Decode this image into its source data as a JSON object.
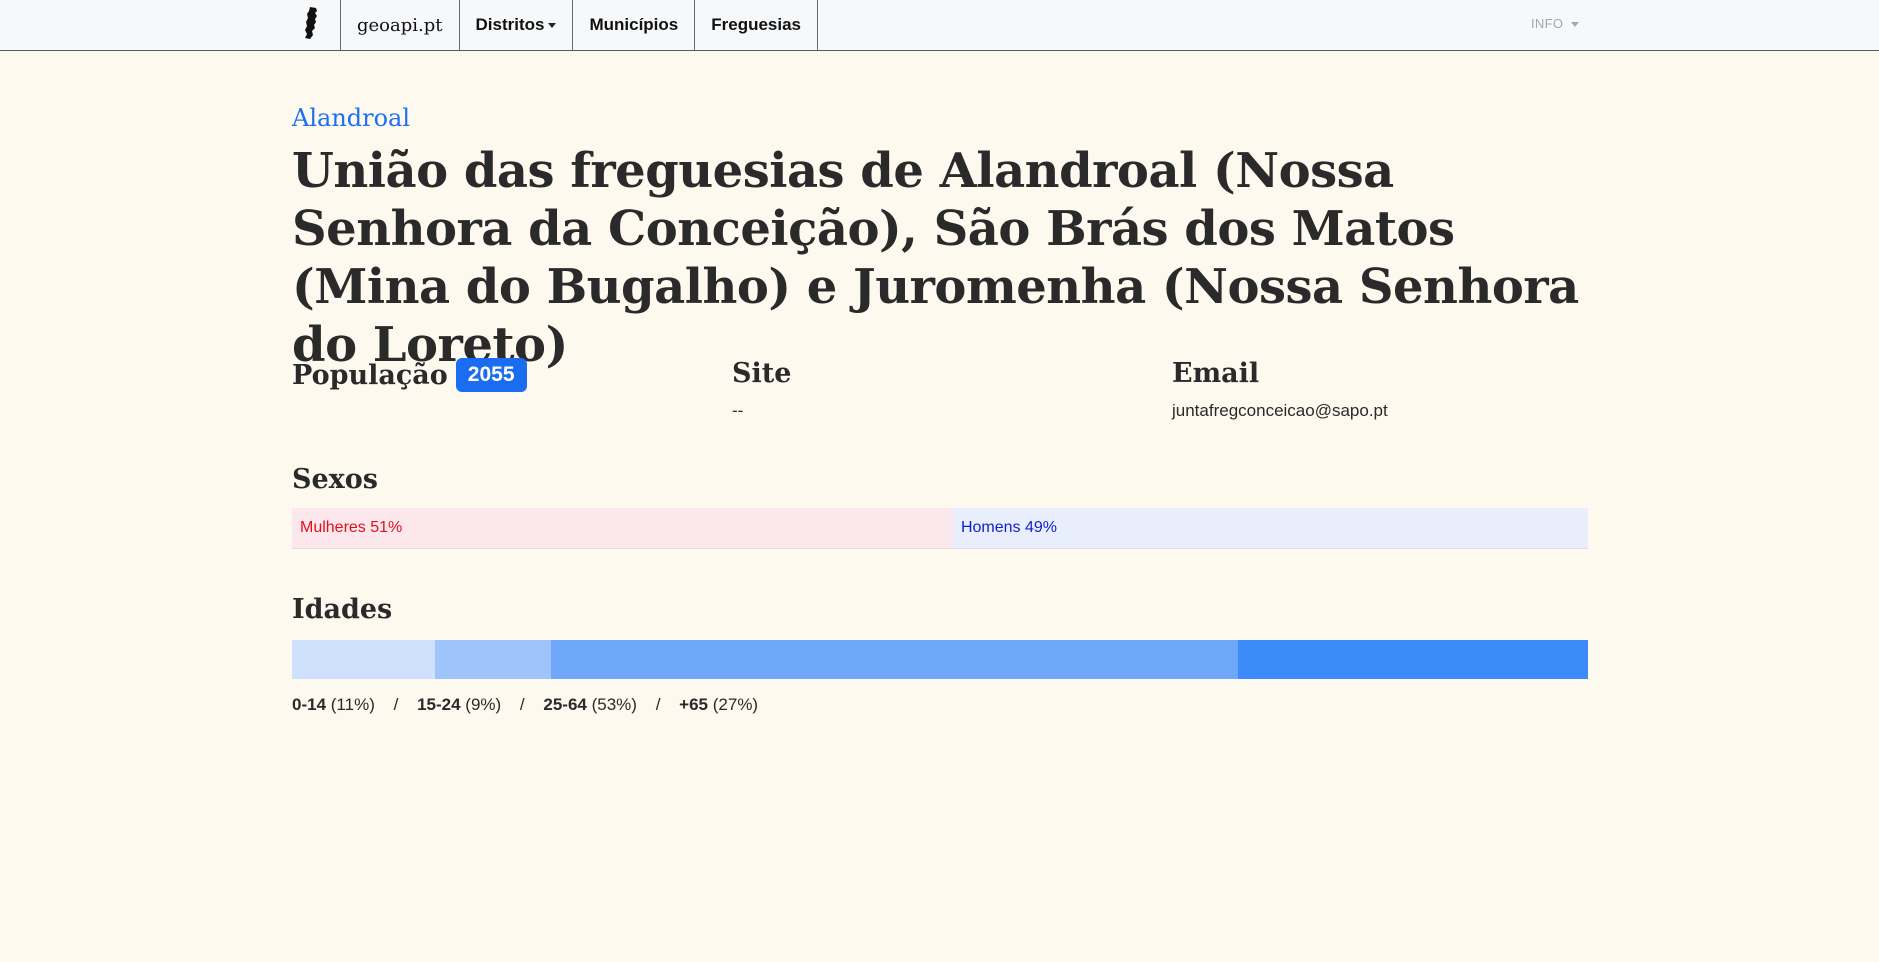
{
  "nav": {
    "brand": "geoapi.pt",
    "items": [
      {
        "label": "Distritos",
        "dropdown": true
      },
      {
        "label": "Municípios",
        "dropdown": false
      },
      {
        "label": "Freguesias",
        "dropdown": false
      }
    ],
    "info_label": "INFO",
    "logo_icon": "portugal-map-icon"
  },
  "page": {
    "parent": "Alandroal",
    "title": "União das freguesias de Alandroal (Nossa Senhora da Conceição), São Brás dos Matos (Mina do Bugalho) e Juromenha (Nossa Senhora do Loreto)"
  },
  "info": {
    "population_label": "População",
    "population_value": "2055",
    "site_label": "Site",
    "site_value": "--",
    "email_label": "Email",
    "email_value": "juntafregconceicao@sapo.pt"
  },
  "sexes": {
    "heading": "Sexos",
    "female": {
      "label": "Mulheres 51%",
      "percent": 51,
      "color": "#fce8ec",
      "text_color": "#e0101e"
    },
    "male": {
      "label": "Homens 49%",
      "percent": 49,
      "color": "#e8eefb",
      "text_color": "#0f1fd0"
    }
  },
  "ages": {
    "heading": "Idades",
    "groups": [
      {
        "range": "0-14",
        "pct_label": "(11%)",
        "percent": 11,
        "color": "#cfe1fd"
      },
      {
        "range": "15-24",
        "pct_label": "(9%)",
        "percent": 9,
        "color": "#9fc4fc"
      },
      {
        "range": "25-64",
        "pct_label": "(53%)",
        "percent": 53,
        "color": "#6fa7fb"
      },
      {
        "range": "+65",
        "pct_label": "(27%)",
        "percent": 27,
        "color": "#3d8bfa"
      }
    ],
    "separator": "/"
  }
}
